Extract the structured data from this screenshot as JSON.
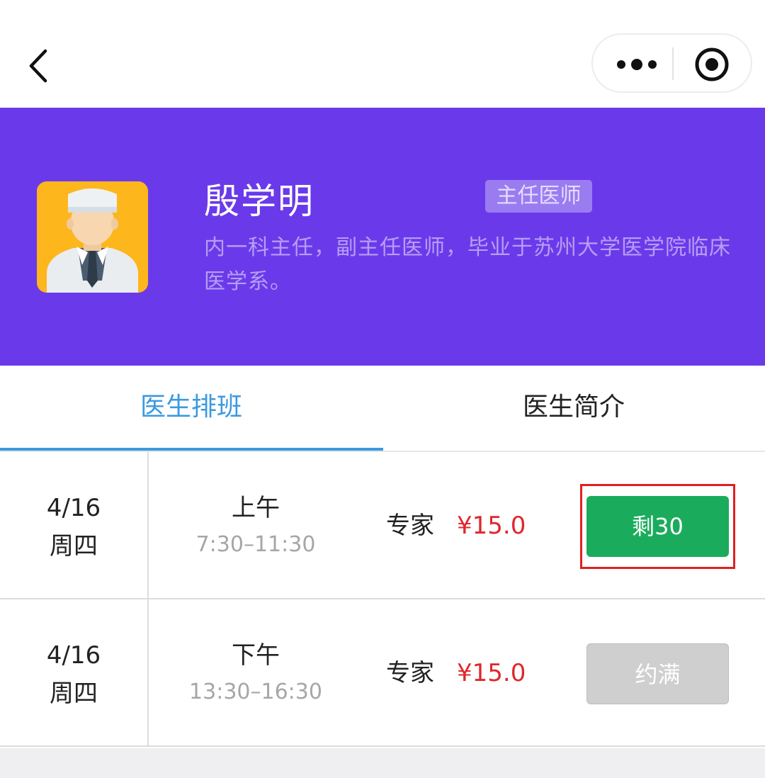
{
  "nav": {
    "back_icon": "chevron-left-icon",
    "more_icon": "more-dots-icon",
    "target_icon": "target-circle-icon"
  },
  "doctor": {
    "name": "殷学明",
    "title": "主任医师",
    "intro": "内一科主任，副主任医师，毕业于苏州大学医学院临床医学系。",
    "avatar_icon": "doctor-avatar-icon"
  },
  "tabs": [
    {
      "label": "医生排班",
      "active": true
    },
    {
      "label": "医生简介",
      "active": false
    }
  ],
  "schedule": [
    {
      "date": "4/16",
      "weekday": "周四",
      "period": "上午",
      "time": "7:30–11:30",
      "level": "专家",
      "price": "¥15.0",
      "slot_label": "剩30",
      "status": "available"
    },
    {
      "date": "4/16",
      "weekday": "周四",
      "period": "下午",
      "time": "13:30–16:30",
      "level": "专家",
      "price": "¥15.0",
      "slot_label": "约满",
      "status": "full"
    }
  ],
  "colors": {
    "hero_bg": "#6a3aea",
    "accent_blue": "#3b99e0",
    "price_red": "#e0262b",
    "available_green": "#1aac5c",
    "full_gray": "#cfcfcf",
    "highlight_red": "#e02020"
  }
}
